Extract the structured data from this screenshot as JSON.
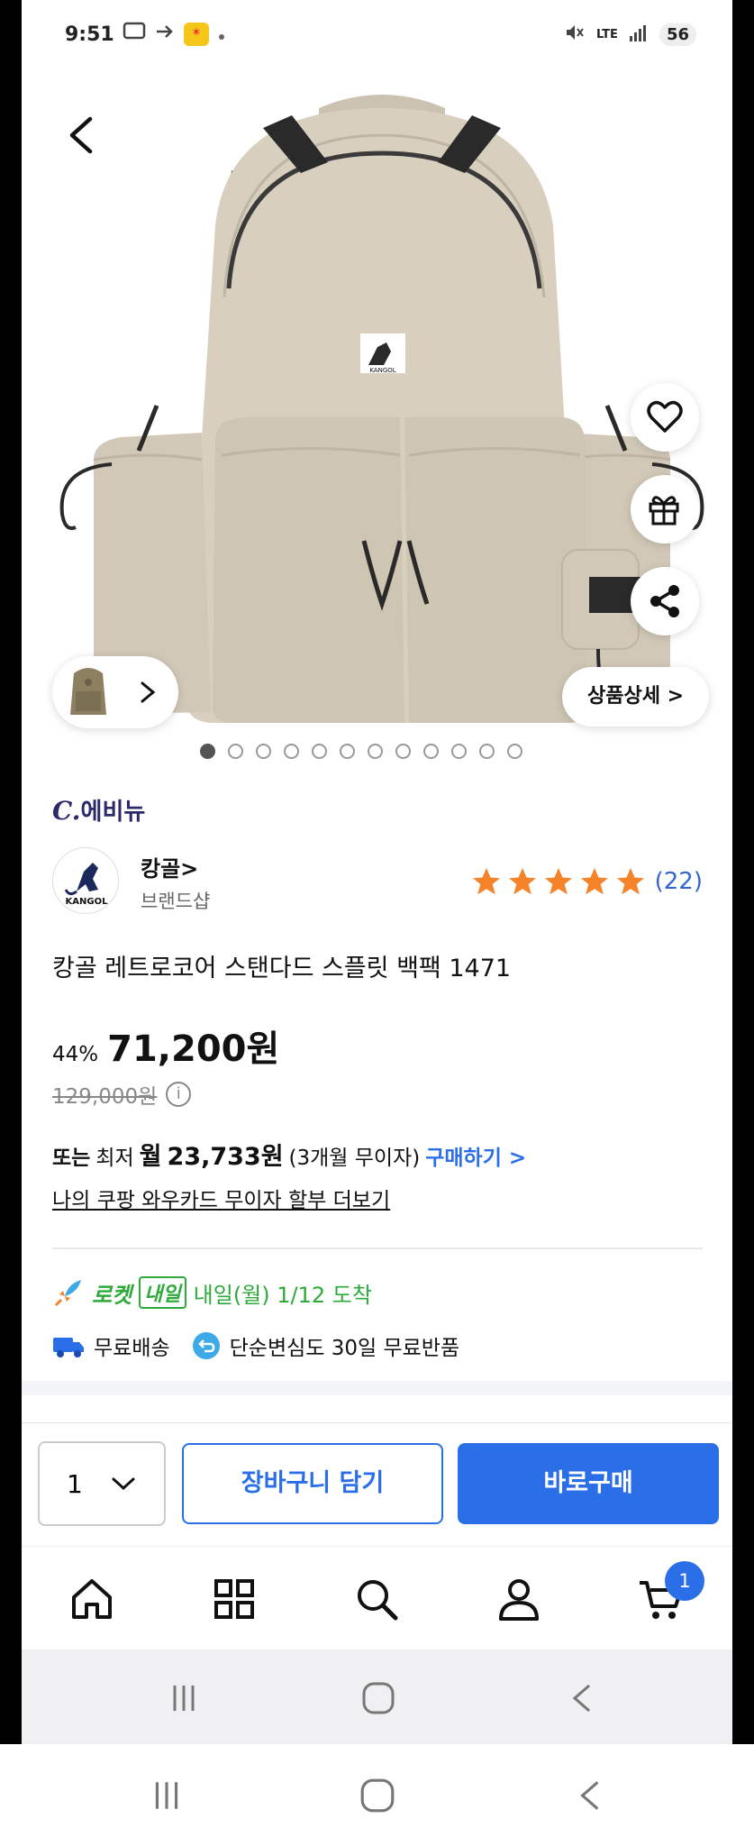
{
  "status_bar": {
    "time": "9:51",
    "notif_label": "*",
    "network": "LTE",
    "battery": "56"
  },
  "gallery": {
    "details_label": "상품상세 >",
    "image_count": 12,
    "active_index": 0
  },
  "seller": {
    "logo_c": "C.",
    "logo_name": "에비뉴"
  },
  "brand": {
    "logo_text": "KANGOL",
    "name": "캉골>",
    "shop_label": "브랜드샵"
  },
  "rating": {
    "stars": 5,
    "review_count": "(22)",
    "star_color": "#f5832a"
  },
  "product": {
    "title": "캉골 레트로코어 스탠다드 스플릿 백팩 1471",
    "discount": "44%",
    "price": "71,200원",
    "original_price": "129,000원",
    "info_icon": "i"
  },
  "installment": {
    "or": "또는",
    "lowest": "최저",
    "month": "월",
    "monthly_price": "23,733원",
    "terms": "(3개월 무이자)",
    "buy_link": "구매하기 >",
    "card_link": "나의 쿠팡 와우카드 무이자 할부 더보기"
  },
  "delivery": {
    "rocket": "로켓",
    "tomorrow": "내일",
    "arrival": "내일(월) 1/12 도착",
    "free_shipping": "무료배송",
    "return_policy": "단순변심도 30일 무료반품",
    "accent_color": "#2eaa3a"
  },
  "purchase_bar": {
    "quantity": "1",
    "cart_label": "장바구니 담기",
    "buy_now_label": "바로구매",
    "accent_color": "#2b6fe8"
  },
  "app_nav": {
    "items": [
      "home-icon",
      "category-icon",
      "search-icon",
      "my-page-icon",
      "cart-icon"
    ],
    "cart_count": "1"
  }
}
